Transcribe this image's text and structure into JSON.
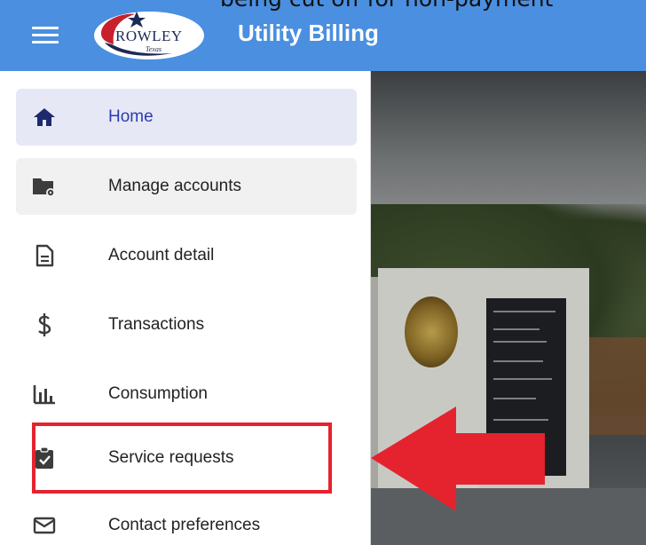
{
  "caption": "being cut off for non-payment",
  "header": {
    "app_title": "Utility Billing",
    "logo_text": "ROWLEY",
    "logo_subtext": "Texas",
    "menu_icon": "hamburger-menu-icon",
    "color": "#4a8fe0"
  },
  "sidebar": {
    "items": [
      {
        "label": "Home",
        "icon": "home-icon",
        "state": "selected"
      },
      {
        "label": "Manage accounts",
        "icon": "folder-settings-icon",
        "state": "hovered"
      },
      {
        "label": "Account detail",
        "icon": "document-icon",
        "state": "normal"
      },
      {
        "label": "Transactions",
        "icon": "dollar-icon",
        "state": "normal"
      },
      {
        "label": "Consumption",
        "icon": "bar-chart-icon",
        "state": "normal"
      },
      {
        "label": "Service requests",
        "icon": "clipboard-check-icon",
        "state": "normal"
      },
      {
        "label": "Contact preferences",
        "icon": "envelope-icon",
        "state": "normal"
      }
    ]
  },
  "annotation": {
    "highlight_color": "#e5232f",
    "highlighted_item": "Service requests"
  }
}
